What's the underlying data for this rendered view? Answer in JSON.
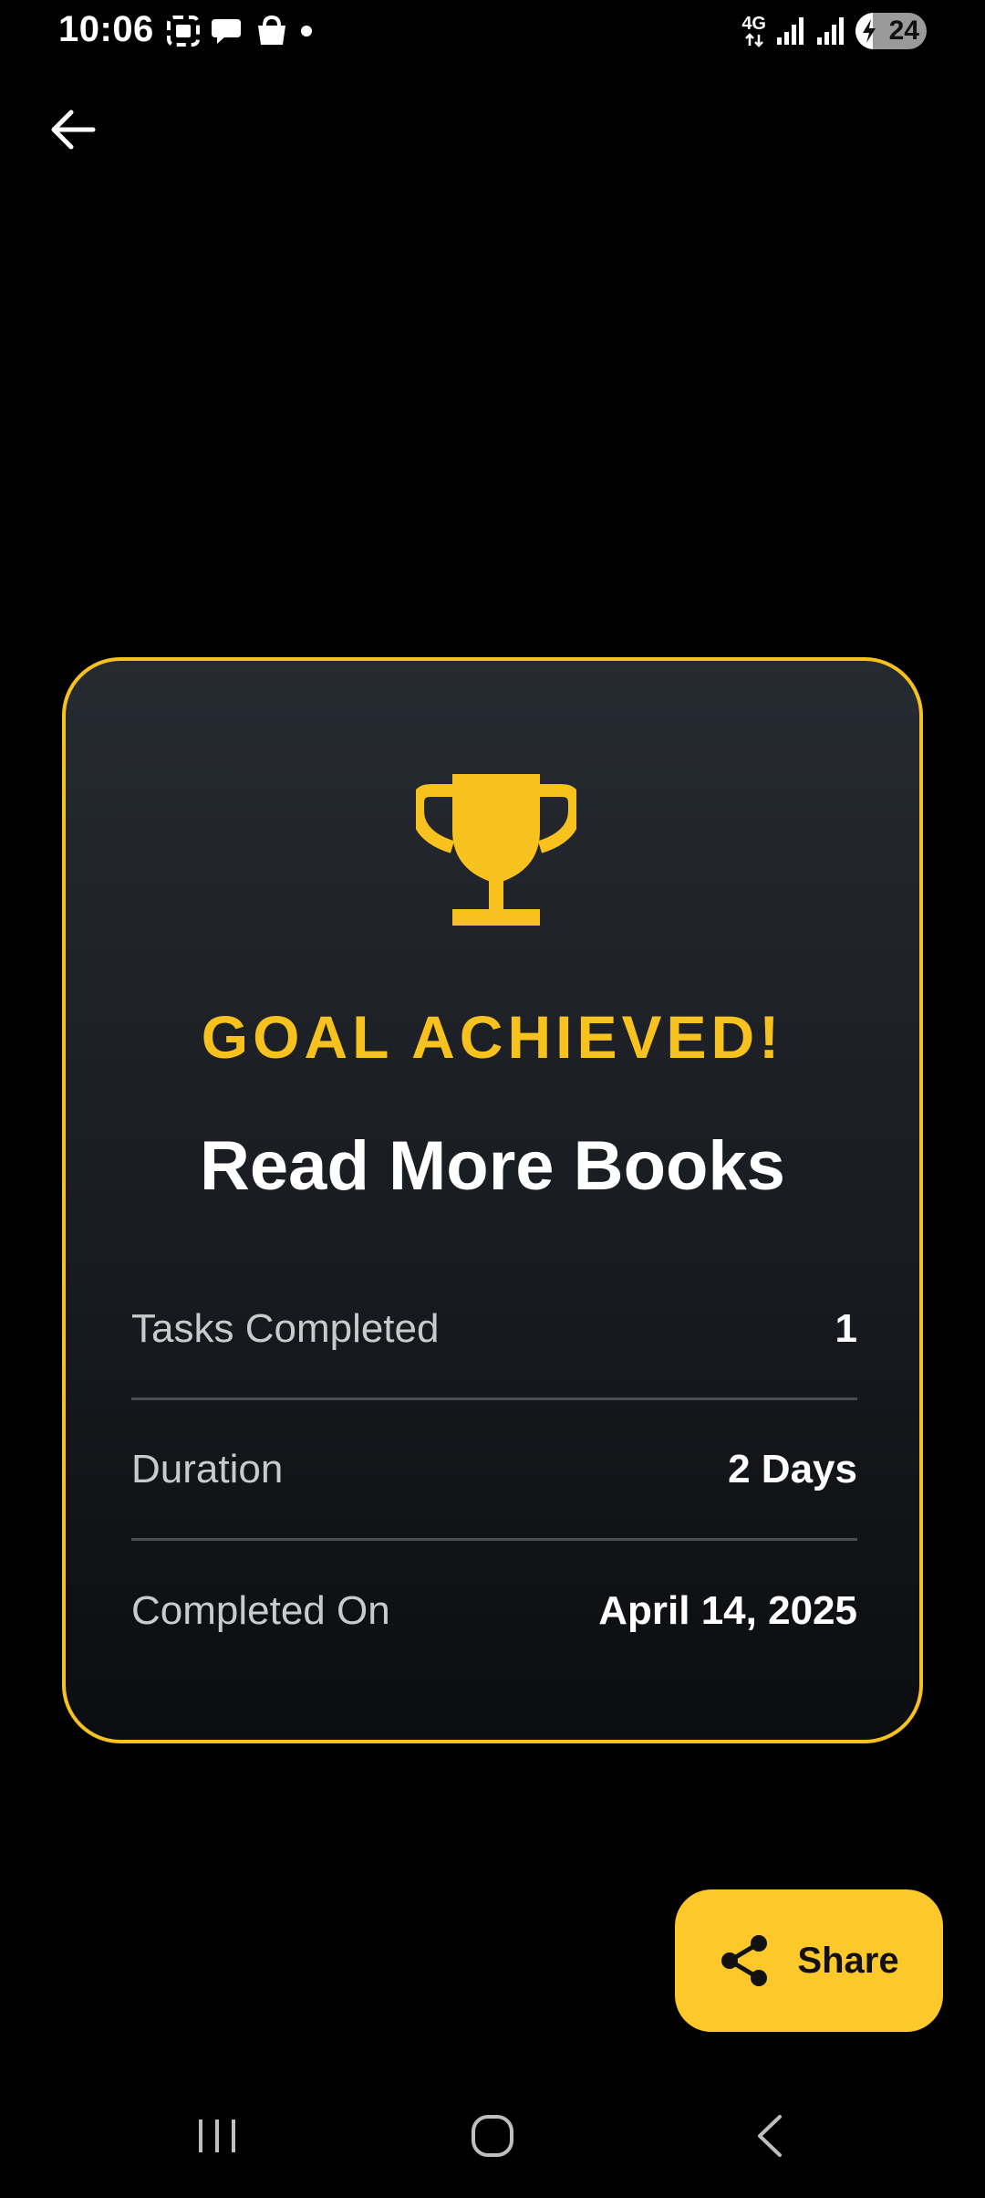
{
  "status_bar": {
    "time": "10:06",
    "network": "4G",
    "battery_level": "24",
    "icons_left": [
      "screenshot-icon",
      "chat-bubble-icon",
      "shopping-bag-icon",
      "dot-icon"
    ],
    "icons_right": [
      "network-4g-icon",
      "signal-icon",
      "signal-icon",
      "battery-charging-icon"
    ]
  },
  "header": {
    "back_icon": "arrow-left-icon"
  },
  "card": {
    "icon": "trophy-icon",
    "label": "GOAL ACHIEVED!",
    "title": "Read More Books",
    "stats": [
      {
        "label": "Tasks Completed",
        "value": "1"
      },
      {
        "label": "Duration",
        "value": "2 Days"
      },
      {
        "label": "Completed On",
        "value": "April 14, 2025"
      }
    ]
  },
  "share_button": {
    "label": "Share",
    "icon": "share-icon"
  },
  "nav_bar": {
    "items": [
      "recent-apps-icon",
      "home-icon",
      "back-icon"
    ]
  },
  "colors": {
    "background": "#000000",
    "accent": "#f7c21d",
    "button": "#fdc82a",
    "card_top": "#262a31",
    "card_bottom": "#0c0d10"
  }
}
